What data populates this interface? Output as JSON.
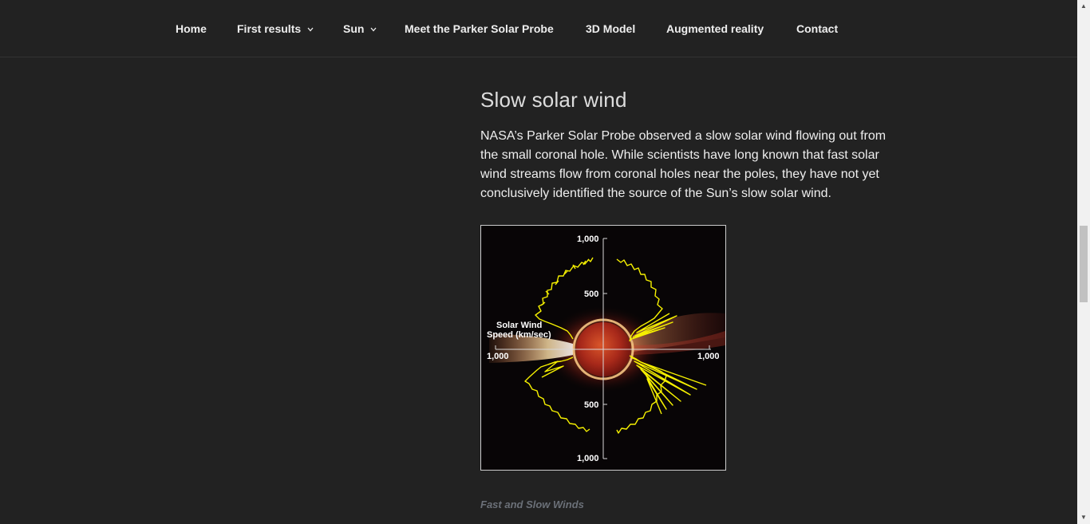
{
  "nav": {
    "items": [
      {
        "label": "Home",
        "has_dropdown": false
      },
      {
        "label": "First results",
        "has_dropdown": true
      },
      {
        "label": "Sun",
        "has_dropdown": true
      },
      {
        "label": "Meet the Parker Solar Probe",
        "has_dropdown": false
      },
      {
        "label": "3D Model",
        "has_dropdown": false
      },
      {
        "label": "Augmented reality",
        "has_dropdown": false
      },
      {
        "label": "Contact",
        "has_dropdown": false
      }
    ]
  },
  "article": {
    "title": "Slow solar wind",
    "intro": "NASA’s Parker Solar Probe observed a slow solar wind flowing out from the small coronal hole. While scientists have long known that fast solar wind streams flow from coronal holes near the poles, they have not yet conclusively identified the source of the Sun’s slow solar wind."
  },
  "figure": {
    "label_line1": "Solar Wind",
    "label_line2": "Speed (km/sec)",
    "axis_top": "1,000",
    "axis_upper_mid": "500",
    "axis_lower_mid": "500",
    "axis_bottom": "1,000",
    "axis_left": "1,000",
    "axis_right": "1,000",
    "caption": "Fast and Slow Winds"
  },
  "colors": {
    "background": "#222222",
    "text": "#eeeeee",
    "caption": "#6b7078",
    "wind_trace": "#f5f000",
    "sun": "#c8321a"
  },
  "icons": {
    "dropdown": "chevron-down-icon",
    "scroll_up": "scroll-up-arrow-icon",
    "scroll_down": "scroll-down-arrow-icon"
  }
}
